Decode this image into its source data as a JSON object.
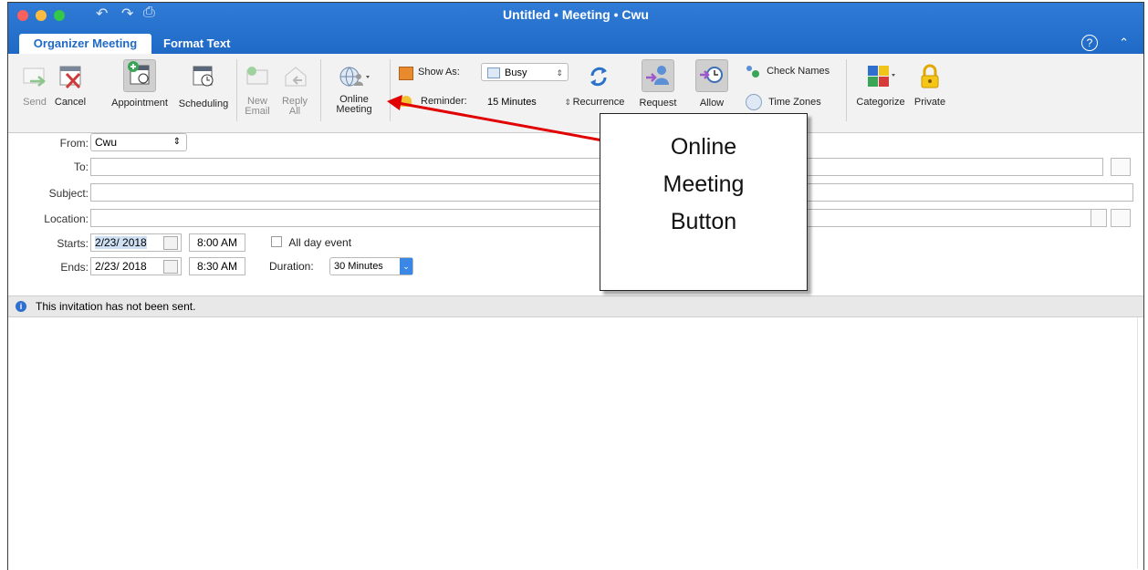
{
  "window": {
    "title": "Untitled • Meeting • Cwu"
  },
  "tabs": [
    {
      "label": "Organizer Meeting"
    },
    {
      "label": "Format Text"
    }
  ],
  "help_label": "?",
  "ribbon": {
    "send": "Send",
    "cancel": "Cancel",
    "appointment": "Appointment",
    "scheduling": "Scheduling",
    "new_email": [
      "New",
      "Email"
    ],
    "reply_all": [
      "Reply",
      "All"
    ],
    "online_meeting": [
      "Online",
      "Meeting"
    ],
    "show_as_label": "Show As:",
    "show_as_value": "Busy",
    "reminder_label": "Reminder:",
    "reminder_value": "15 Minutes",
    "recurrence": "Recurrence",
    "request_responses": "Request",
    "allow_new_time": "Allow",
    "check_names": "Check Names",
    "time_zones": "Time Zones",
    "categorize": "Categorize",
    "private": "Private"
  },
  "form": {
    "from_label": "From:",
    "from_value": "Cwu",
    "to_label": "To:",
    "to_value": "",
    "subject_label": "Subject:",
    "subject_value": "",
    "location_label": "Location:",
    "location_value": "",
    "starts_label": "Starts:",
    "start_date": "2/23/ 2018",
    "start_time": "8:00 AM",
    "all_day_label": "All day event",
    "ends_label": "Ends:",
    "end_date": "2/23/ 2018",
    "end_time": "8:30 AM",
    "duration_label": "Duration:",
    "duration_value": "30 Minutes"
  },
  "info_text": "This invitation has not been sent.",
  "callout": {
    "lines": [
      "Online",
      "Meeting",
      "Button"
    ]
  },
  "colors": {
    "titlebar": "#1f6ac6",
    "arrow": "#e00000"
  }
}
